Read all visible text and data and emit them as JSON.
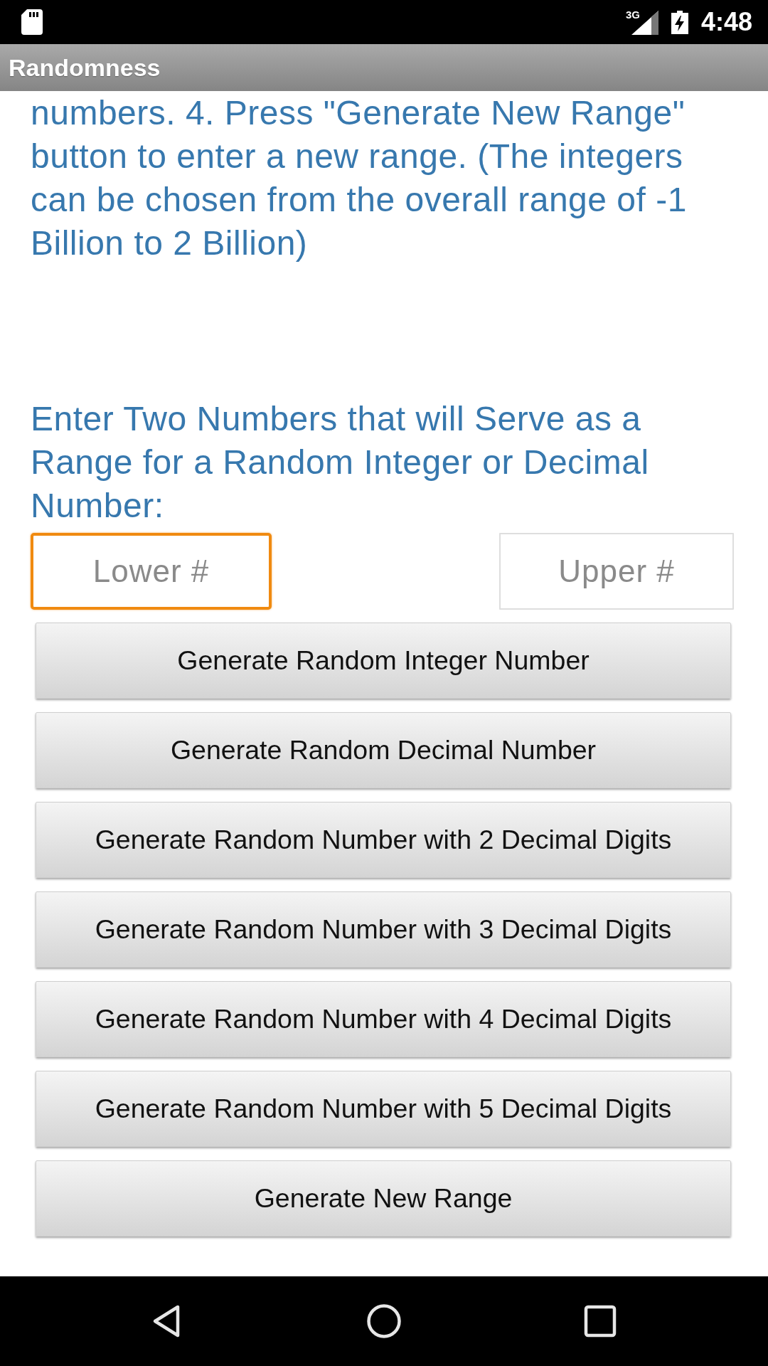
{
  "status_bar": {
    "network": "3G",
    "time": "4:48"
  },
  "title_bar": {
    "title": "Randomness"
  },
  "instructions": "numbers. 4. Press \"Generate New Range\" button to enter a new range. (The integers can be chosen from the overall range of -1 Billion to 2 Billion)",
  "range_prompt": "Enter Two Numbers that will Serve as a Range for a Random Integer or Decimal Number:",
  "inputs": [
    {
      "placeholder": "Lower #",
      "focused": true
    },
    {
      "placeholder": "Upper #",
      "focused": false
    }
  ],
  "buttons": [
    {
      "label": "Generate Random Integer Number"
    },
    {
      "label": "Generate Random Decimal Number"
    },
    {
      "label": "Generate Random Number with 2 Decimal Digits"
    },
    {
      "label": "Generate Random Number with 3 Decimal Digits"
    },
    {
      "label": "Generate Random Number with 4 Decimal Digits"
    },
    {
      "label": "Generate Random Number with 5 Decimal Digits"
    },
    {
      "label": "Generate New Range"
    }
  ]
}
